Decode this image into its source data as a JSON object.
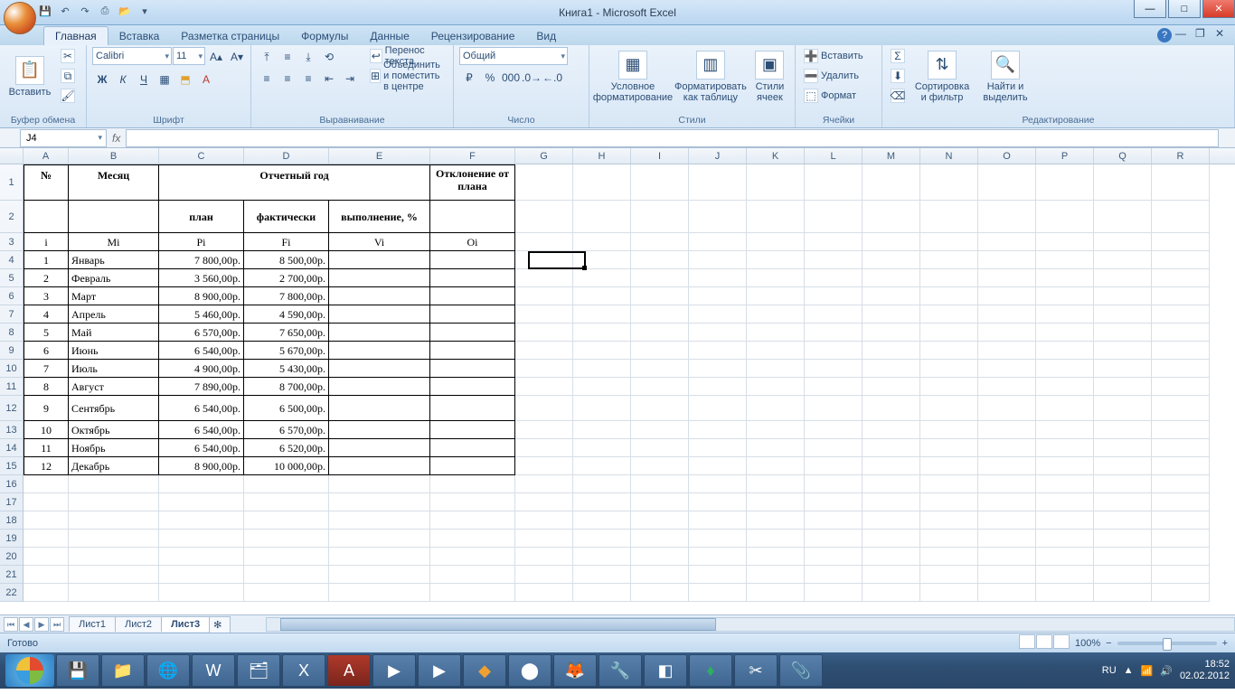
{
  "window": {
    "title": "Книга1 - Microsoft Excel"
  },
  "qat_icons": [
    "save-icon",
    "undo-icon",
    "redo-icon",
    "print-icon",
    "open-icon"
  ],
  "tabs": {
    "items": [
      "Главная",
      "Вставка",
      "Разметка страницы",
      "Формулы",
      "Данные",
      "Рецензирование",
      "Вид"
    ],
    "active": "Главная"
  },
  "ribbon": {
    "clipboard": {
      "title": "Буфер обмена",
      "paste": "Вставить"
    },
    "font": {
      "title": "Шрифт",
      "name": "Calibri",
      "size": "11"
    },
    "alignment": {
      "title": "Выравнивание",
      "wrap": "Перенос текста",
      "merge": "Объединить и поместить в центре"
    },
    "number": {
      "title": "Число",
      "format": "Общий"
    },
    "styles": {
      "title": "Стили",
      "cond": "Условное форматирование",
      "table": "Форматировать как таблицу",
      "cell": "Стили ячеек"
    },
    "cells": {
      "title": "Ячейки",
      "insert": "Вставить",
      "delete": "Удалить",
      "format": "Формат"
    },
    "editing": {
      "title": "Редактирование",
      "sort": "Сортировка и фильтр",
      "find": "Найти и выделить"
    }
  },
  "formula_bar": {
    "name_box": "J4",
    "fx": ""
  },
  "columns": [
    "A",
    "B",
    "C",
    "D",
    "E",
    "F",
    "G",
    "H",
    "I",
    "J",
    "K",
    "L",
    "M",
    "N",
    "O",
    "P",
    "Q",
    "R"
  ],
  "row_count": 22,
  "worksheet": {
    "header1": {
      "num": "№",
      "month": "Месяц",
      "year": "Отчетный год",
      "dev": "Отклонение от плана"
    },
    "header2": {
      "plan": "план",
      "fact": "фактически",
      "perf": "выполнение, %"
    },
    "header3": {
      "a": "i",
      "b": "Mi",
      "c": "Pi",
      "d": "Fi",
      "e": "Vi",
      "f": "Oi"
    },
    "rows": [
      {
        "i": "1",
        "m": "Январь",
        "p": "7 800,00р.",
        "f": "8 500,00р."
      },
      {
        "i": "2",
        "m": "Февраль",
        "p": "3 560,00р.",
        "f": "2 700,00р."
      },
      {
        "i": "3",
        "m": "Март",
        "p": "8 900,00р.",
        "f": "7 800,00р."
      },
      {
        "i": "4",
        "m": "Апрель",
        "p": "5 460,00р.",
        "f": "4 590,00р."
      },
      {
        "i": "5",
        "m": "Май",
        "p": "6 570,00р.",
        "f": "7 650,00р."
      },
      {
        "i": "6",
        "m": "Июнь",
        "p": "6 540,00р.",
        "f": "5 670,00р."
      },
      {
        "i": "7",
        "m": "Июль",
        "p": "4 900,00р.",
        "f": "5 430,00р."
      },
      {
        "i": "8",
        "m": "Август",
        "p": "7 890,00р.",
        "f": "8 700,00р."
      },
      {
        "i": "9",
        "m": "Сентябрь",
        "p": "6 540,00р.",
        "f": "6 500,00р."
      },
      {
        "i": "10",
        "m": "Октябрь",
        "p": "6 540,00р.",
        "f": "6 570,00р."
      },
      {
        "i": "11",
        "m": "Ноябрь",
        "p": "6 540,00р.",
        "f": "6 520,00р."
      },
      {
        "i": "12",
        "m": "Декабрь",
        "p": "8 900,00р.",
        "f": "10 000,00р."
      }
    ]
  },
  "sheet_tabs": {
    "items": [
      "Лист1",
      "Лист2",
      "Лист3"
    ],
    "active": "Лист3"
  },
  "status": {
    "ready": "Готово",
    "zoom": "100%"
  },
  "taskbar": {
    "lang": "RU",
    "time": "18:52",
    "date": "02.02.2012"
  }
}
